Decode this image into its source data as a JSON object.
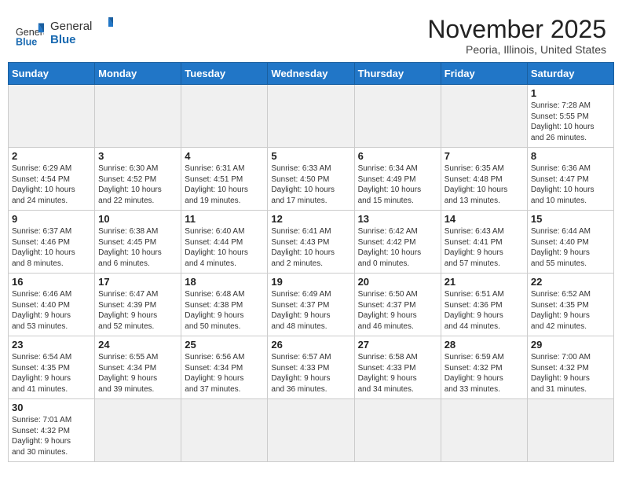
{
  "header": {
    "logo_general": "General",
    "logo_blue": "Blue",
    "month_title": "November 2025",
    "location": "Peoria, Illinois, United States"
  },
  "columns": [
    "Sunday",
    "Monday",
    "Tuesday",
    "Wednesday",
    "Thursday",
    "Friday",
    "Saturday"
  ],
  "weeks": [
    [
      {
        "day": "",
        "info": ""
      },
      {
        "day": "",
        "info": ""
      },
      {
        "day": "",
        "info": ""
      },
      {
        "day": "",
        "info": ""
      },
      {
        "day": "",
        "info": ""
      },
      {
        "day": "",
        "info": ""
      },
      {
        "day": "1",
        "info": "Sunrise: 7:28 AM\nSunset: 5:55 PM\nDaylight: 10 hours\nand 26 minutes."
      }
    ],
    [
      {
        "day": "2",
        "info": "Sunrise: 6:29 AM\nSunset: 4:54 PM\nDaylight: 10 hours\nand 24 minutes."
      },
      {
        "day": "3",
        "info": "Sunrise: 6:30 AM\nSunset: 4:52 PM\nDaylight: 10 hours\nand 22 minutes."
      },
      {
        "day": "4",
        "info": "Sunrise: 6:31 AM\nSunset: 4:51 PM\nDaylight: 10 hours\nand 19 minutes."
      },
      {
        "day": "5",
        "info": "Sunrise: 6:33 AM\nSunset: 4:50 PM\nDaylight: 10 hours\nand 17 minutes."
      },
      {
        "day": "6",
        "info": "Sunrise: 6:34 AM\nSunset: 4:49 PM\nDaylight: 10 hours\nand 15 minutes."
      },
      {
        "day": "7",
        "info": "Sunrise: 6:35 AM\nSunset: 4:48 PM\nDaylight: 10 hours\nand 13 minutes."
      },
      {
        "day": "8",
        "info": "Sunrise: 6:36 AM\nSunset: 4:47 PM\nDaylight: 10 hours\nand 10 minutes."
      }
    ],
    [
      {
        "day": "9",
        "info": "Sunrise: 6:37 AM\nSunset: 4:46 PM\nDaylight: 10 hours\nand 8 minutes."
      },
      {
        "day": "10",
        "info": "Sunrise: 6:38 AM\nSunset: 4:45 PM\nDaylight: 10 hours\nand 6 minutes."
      },
      {
        "day": "11",
        "info": "Sunrise: 6:40 AM\nSunset: 4:44 PM\nDaylight: 10 hours\nand 4 minutes."
      },
      {
        "day": "12",
        "info": "Sunrise: 6:41 AM\nSunset: 4:43 PM\nDaylight: 10 hours\nand 2 minutes."
      },
      {
        "day": "13",
        "info": "Sunrise: 6:42 AM\nSunset: 4:42 PM\nDaylight: 10 hours\nand 0 minutes."
      },
      {
        "day": "14",
        "info": "Sunrise: 6:43 AM\nSunset: 4:41 PM\nDaylight: 9 hours\nand 57 minutes."
      },
      {
        "day": "15",
        "info": "Sunrise: 6:44 AM\nSunset: 4:40 PM\nDaylight: 9 hours\nand 55 minutes."
      }
    ],
    [
      {
        "day": "16",
        "info": "Sunrise: 6:46 AM\nSunset: 4:40 PM\nDaylight: 9 hours\nand 53 minutes."
      },
      {
        "day": "17",
        "info": "Sunrise: 6:47 AM\nSunset: 4:39 PM\nDaylight: 9 hours\nand 52 minutes."
      },
      {
        "day": "18",
        "info": "Sunrise: 6:48 AM\nSunset: 4:38 PM\nDaylight: 9 hours\nand 50 minutes."
      },
      {
        "day": "19",
        "info": "Sunrise: 6:49 AM\nSunset: 4:37 PM\nDaylight: 9 hours\nand 48 minutes."
      },
      {
        "day": "20",
        "info": "Sunrise: 6:50 AM\nSunset: 4:37 PM\nDaylight: 9 hours\nand 46 minutes."
      },
      {
        "day": "21",
        "info": "Sunrise: 6:51 AM\nSunset: 4:36 PM\nDaylight: 9 hours\nand 44 minutes."
      },
      {
        "day": "22",
        "info": "Sunrise: 6:52 AM\nSunset: 4:35 PM\nDaylight: 9 hours\nand 42 minutes."
      }
    ],
    [
      {
        "day": "23",
        "info": "Sunrise: 6:54 AM\nSunset: 4:35 PM\nDaylight: 9 hours\nand 41 minutes."
      },
      {
        "day": "24",
        "info": "Sunrise: 6:55 AM\nSunset: 4:34 PM\nDaylight: 9 hours\nand 39 minutes."
      },
      {
        "day": "25",
        "info": "Sunrise: 6:56 AM\nSunset: 4:34 PM\nDaylight: 9 hours\nand 37 minutes."
      },
      {
        "day": "26",
        "info": "Sunrise: 6:57 AM\nSunset: 4:33 PM\nDaylight: 9 hours\nand 36 minutes."
      },
      {
        "day": "27",
        "info": "Sunrise: 6:58 AM\nSunset: 4:33 PM\nDaylight: 9 hours\nand 34 minutes."
      },
      {
        "day": "28",
        "info": "Sunrise: 6:59 AM\nSunset: 4:32 PM\nDaylight: 9 hours\nand 33 minutes."
      },
      {
        "day": "29",
        "info": "Sunrise: 7:00 AM\nSunset: 4:32 PM\nDaylight: 9 hours\nand 31 minutes."
      }
    ],
    [
      {
        "day": "30",
        "info": "Sunrise: 7:01 AM\nSunset: 4:32 PM\nDaylight: 9 hours\nand 30 minutes."
      },
      {
        "day": "",
        "info": ""
      },
      {
        "day": "",
        "info": ""
      },
      {
        "day": "",
        "info": ""
      },
      {
        "day": "",
        "info": ""
      },
      {
        "day": "",
        "info": ""
      },
      {
        "day": "",
        "info": ""
      }
    ]
  ]
}
